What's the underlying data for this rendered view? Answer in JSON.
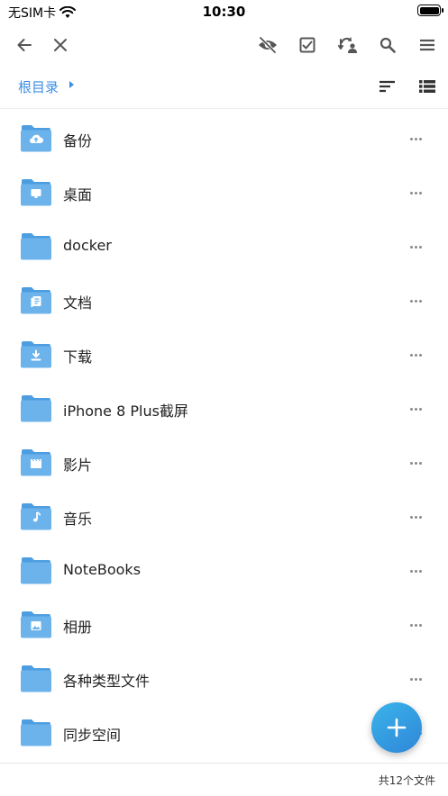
{
  "status": {
    "carrier": "无SIM卡",
    "time": "10:30",
    "icons": [
      "wifi-icon",
      "battery-icon"
    ]
  },
  "toolbar": {
    "left_icons": [
      "back-arrow-icon",
      "close-icon"
    ],
    "right_icons": [
      "eye-off-icon",
      "checkbox-icon",
      "sync-icon",
      "search-icon",
      "menu-icon"
    ]
  },
  "breadcrumb": {
    "root_label": "根目录"
  },
  "view_controls": {
    "icons": [
      "sort-icon",
      "list-view-icon"
    ]
  },
  "files": [
    {
      "name": "备份",
      "badge": "cloud-upload-icon"
    },
    {
      "name": "桌面",
      "badge": "monitor-icon"
    },
    {
      "name": "docker",
      "badge": ""
    },
    {
      "name": "文档",
      "badge": "document-icon"
    },
    {
      "name": "下载",
      "badge": "download-icon"
    },
    {
      "name": "iPhone 8 Plus截屏",
      "badge": ""
    },
    {
      "name": "影片",
      "badge": "film-icon"
    },
    {
      "name": "音乐",
      "badge": "music-note-icon"
    },
    {
      "name": "NoteBooks",
      "badge": ""
    },
    {
      "name": "相册",
      "badge": "image-icon"
    },
    {
      "name": "各种类型文件",
      "badge": ""
    },
    {
      "name": "同步空间",
      "badge": ""
    }
  ],
  "footer": {
    "count_text": "共12个文件"
  },
  "colors": {
    "accent": "#3d8ee6",
    "folder": "#6cb3ec",
    "folder_back": "#4d9ee0",
    "fab": "#2f86d8"
  }
}
